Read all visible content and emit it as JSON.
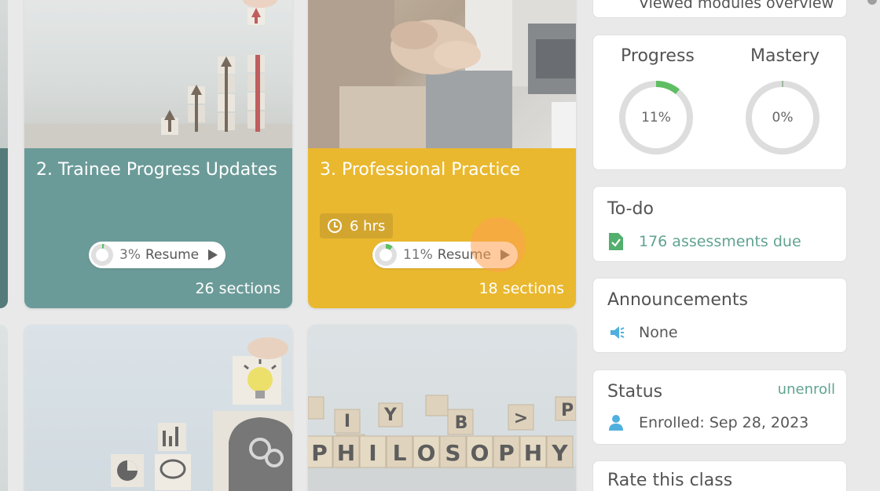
{
  "top_panel": {
    "text": "Viewed modules overview"
  },
  "progress_panel": {
    "progress_label": "Progress",
    "mastery_label": "Mastery",
    "progress_value": "11%",
    "mastery_value": "0%",
    "progress_fraction": 0.11,
    "mastery_fraction": 0.0
  },
  "todo_panel": {
    "title": "To-do",
    "item": "176 assessments due"
  },
  "announcements_panel": {
    "title": "Announcements",
    "item": "None"
  },
  "status_panel": {
    "title": "Status",
    "unenroll": "unenroll",
    "enrolled": "Enrolled: Sep 28, 2023"
  },
  "rate_panel": {
    "title": "Rate this class"
  },
  "cards": [
    {
      "title": "2. Trainee Progress Updates",
      "resume_pct": "3%",
      "resume_label": "Resume",
      "resume_fraction": 0.03,
      "sections": "26 sections",
      "color": "#2f6e6b"
    },
    {
      "title": "3. Professional Practice",
      "hours": "6 hrs",
      "resume_pct": "11%",
      "resume_label": "Resume",
      "resume_fraction": 0.11,
      "sections": "18 sections",
      "color": "#e0a400"
    }
  ],
  "philosophy_blocks": [
    "P",
    "H",
    "I",
    "L",
    "O",
    "S",
    "O",
    "P",
    "H",
    "Y"
  ],
  "colors": {
    "accent_green": "#2a8a6a",
    "ring_green": "#3cb043",
    "icon_blue": "#2a9fd6",
    "announce_icon": "#2a9fd6"
  }
}
